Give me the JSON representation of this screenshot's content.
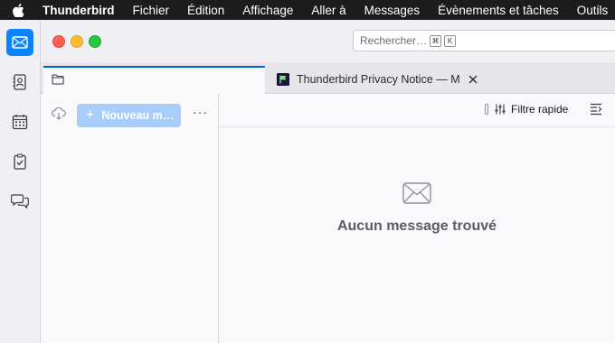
{
  "menubar": {
    "app_name": "Thunderbird",
    "items": [
      "Fichier",
      "Édition",
      "Affichage",
      "Aller à",
      "Messages",
      "Évènements et tâches",
      "Outils"
    ]
  },
  "search": {
    "placeholder": "Rechercher…",
    "shortcut_keys": [
      "⌘",
      "K"
    ]
  },
  "tabs": [
    {
      "icon": "folder-icon",
      "title": ""
    },
    {
      "icon": "thunderbird-flag-favicon",
      "title": "Thunderbird Privacy Notice — Mozilla"
    }
  ],
  "folder_pane": {
    "new_message_label": "Nouveau m…",
    "more_label": "···"
  },
  "thread_pane": {
    "quick_filter_label": "Filtre rapide",
    "empty_message": "Aucun message trouvé"
  },
  "colors": {
    "accent": "#0a84ff",
    "new_message_button": "#a9cdfb",
    "active_tab_border": "#0060df"
  }
}
